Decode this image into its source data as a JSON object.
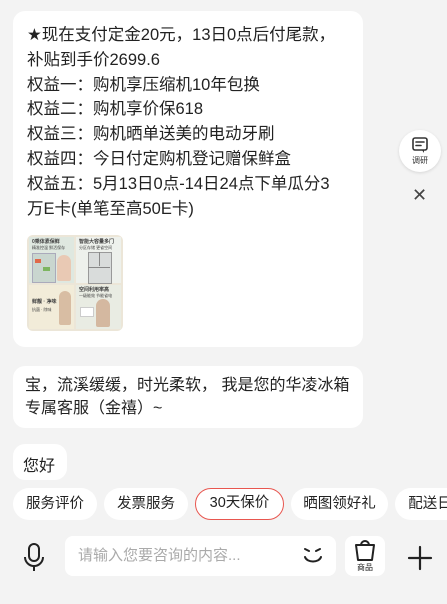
{
  "promo": {
    "lines": [
      "★现在支付定金20元，13日0点后付尾款，",
      "补贴到手价2699.6",
      "权益一：购机享压缩机10年包换",
      "权益二：购机享价保618",
      "权益三：购机晒单送美的电动牙刷",
      "权益四：今日付定购机登记赠保鲜盒",
      "权益五：5月13日0点-14日24点下单瓜分3",
      "万E卡(单笔至高50E卡)"
    ],
    "thumbnail": {
      "panel1": "0乘体素保鲜",
      "panel1_sub": "精准控温 鲜活保存",
      "panel2": "智能大容量多门",
      "panel2_sub": "分区存储 更省空间",
      "panel3": "鲜靓 · 净味",
      "panel3_sub": "抗菌 · 除味",
      "panel4": "空间利用率高",
      "panel4_sub": "一级能效 节能省电"
    }
  },
  "greeting": {
    "lines": [
      "宝，流溪缓缓，时光柔软， 我是您的华凌冰箱",
      "专属客服（金禧）~"
    ]
  },
  "user_message": "您好",
  "side": {
    "survey_label": "调研",
    "close_glyph": "✕"
  },
  "chips": [
    "服务评价",
    "发票服务",
    "30天保价",
    "晒图领好礼",
    "配送日"
  ],
  "input": {
    "placeholder": "请输入您要咨询的内容...",
    "goods_label": "商品"
  },
  "colors": {
    "accent": "#e8564f",
    "background": "#f3f3f3"
  },
  "icons": [
    "survey-icon",
    "close-icon",
    "microphone-icon",
    "emoji-icon",
    "shopping-bag-icon",
    "plus-icon"
  ]
}
